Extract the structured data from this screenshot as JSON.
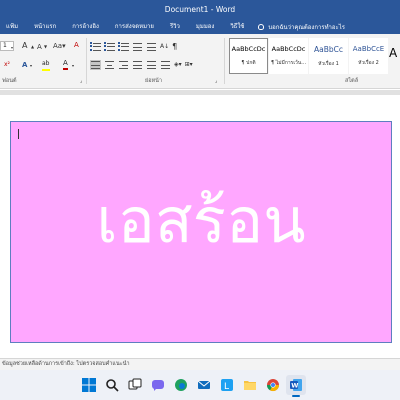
{
  "window": {
    "title": "Document1 - Word"
  },
  "ribbon_tabs": [
    "แฟ้ม",
    "หน้าแรก",
    "การอ้างอิง",
    "การส่งจดหมาย",
    "รีวิว",
    "มุมมอง",
    "วิธีใช้"
  ],
  "tell_me": "บอกฉันว่าคุณต้องการทำอะไร",
  "font_group": {
    "font_size": "1",
    "label": "ฟอนต์",
    "grow": "A",
    "shrink": "A",
    "text_effects": "A",
    "highlight": "ab",
    "font_color": "A"
  },
  "paragraph_group": {
    "label": "ย่อหน้า",
    "marks": "¶"
  },
  "styles_group": {
    "label": "สไตล์",
    "items": [
      {
        "sample": "AaBbCcDc",
        "name": "¶ ปกติ"
      },
      {
        "sample": "AaBbCcDc",
        "name": "¶ ไม่มีการเว้น..."
      },
      {
        "sample": "AaBbCc",
        "name": "หัวเรื่อง 1"
      },
      {
        "sample": "AaBbCcE",
        "name": "หัวเรื่อง 2"
      }
    ],
    "more": "A"
  },
  "document": {
    "text": "เอสร้อน",
    "box_color": "#ffa7ff",
    "text_color": "#ffffff"
  },
  "status_bar": {
    "text": "ข้อมูลช่วยเหลือด้านการเข้าถึง: ไปตรวจสอบคำแนะนำ"
  },
  "taskbar": {
    "items": [
      "start",
      "search",
      "task-view",
      "chat",
      "edge",
      "mail",
      "libreoffice",
      "file-explorer",
      "chrome",
      "word"
    ],
    "active": "word"
  },
  "colors": {
    "accent": "#2b579a"
  }
}
